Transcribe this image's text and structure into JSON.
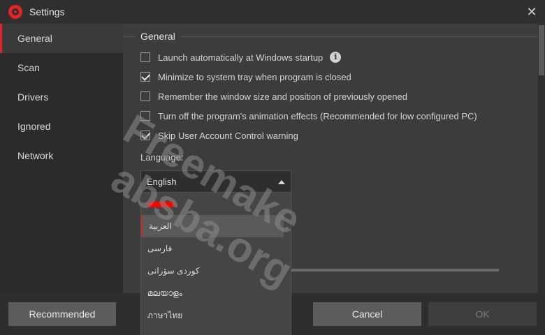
{
  "window": {
    "title": "Settings",
    "close_glyph": "✕",
    "icon": "app-logo-icon"
  },
  "sidebar": {
    "items": [
      {
        "label": "General",
        "active": true
      },
      {
        "label": "Scan",
        "active": false
      },
      {
        "label": "Drivers",
        "active": false
      },
      {
        "label": "Ignored",
        "active": false
      },
      {
        "label": "Network",
        "active": false
      }
    ]
  },
  "general": {
    "section_title": "General",
    "options": [
      {
        "label": "Launch automatically at Windows startup",
        "checked": false,
        "info": true
      },
      {
        "label": "Minimize to system tray when program is closed",
        "checked": true
      },
      {
        "label": "Remember the window size and position of previously opened",
        "checked": false
      },
      {
        "label": "Turn off the program's animation effects (Recommended for low configured PC)",
        "checked": false
      },
      {
        "label": "Skip User Account Control warning",
        "checked": true
      }
    ],
    "info_glyph": "i",
    "language_label": "Language:",
    "language_value": "English"
  },
  "dropdown": {
    "options": [
      {
        "label": "",
        "redacted": true
      },
      {
        "label": "العربية",
        "selected": true
      },
      {
        "label": "فارسی"
      },
      {
        "label": "کوردی سۆرانی"
      },
      {
        "label": "മലയാളം"
      },
      {
        "label": "ภาษาไทย"
      }
    ]
  },
  "footer": {
    "recommended_label": "Recommended",
    "cancel_label": "Cancel",
    "ok_label": "OK"
  },
  "watermark": {
    "line1": "Freemake",
    "line2": "absba.org"
  },
  "colors": {
    "accent": "#e2232a",
    "redaction": "#ff0000"
  }
}
